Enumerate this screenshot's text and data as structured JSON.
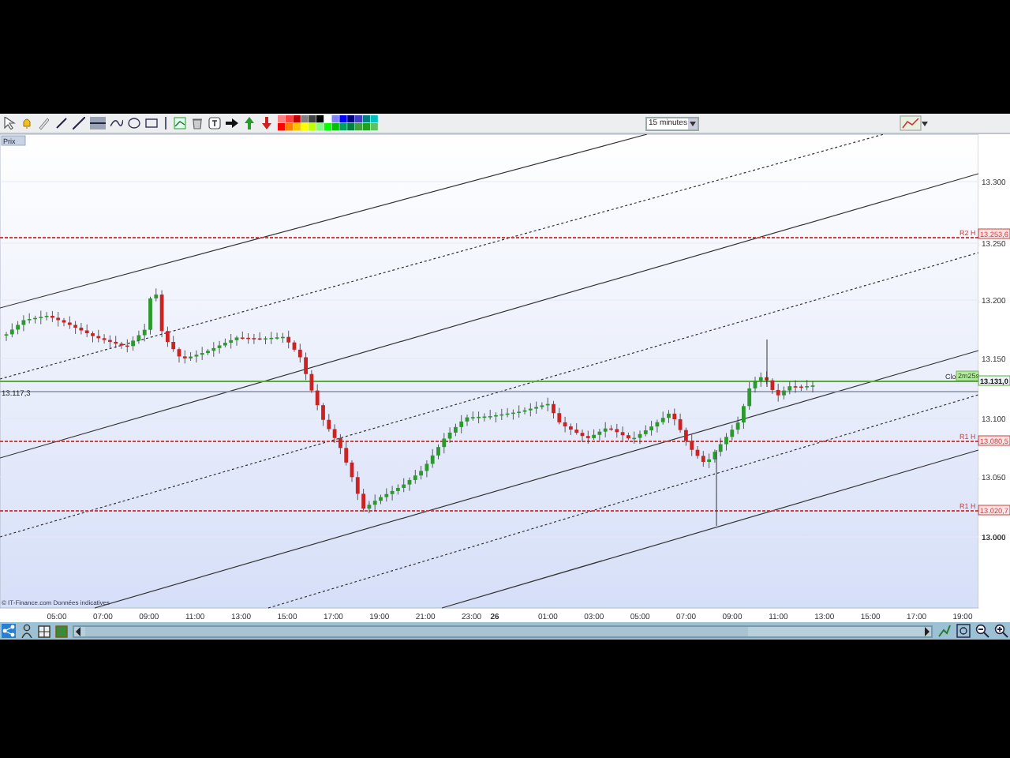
{
  "toolbar": {
    "timeframe": "15 minutes"
  },
  "chart": {
    "panel_label": "Prix",
    "y_axis_labels": [
      "13.300",
      "13.250",
      "13.200",
      "13.150",
      "13.100",
      "13.050",
      "13.000"
    ],
    "price_markers": [
      {
        "label": "R2 H",
        "value": "13.253,6",
        "color": "#d04040"
      },
      {
        "label": "Clo",
        "badge": "2m25s",
        "value": "13.131,0",
        "color": "#5aaa3a"
      },
      {
        "label": "R1 H",
        "value": "13.080,5",
        "color": "#d04040"
      },
      {
        "label": "R1 H",
        "value": "13.020,7",
        "color": "#d04040"
      }
    ],
    "left_marker": "13.117,3",
    "credit": "© IT-Finance.com  Données indicatives",
    "x_axis_labels": [
      {
        "text": "05:00",
        "bold": false
      },
      {
        "text": "07:00",
        "bold": false
      },
      {
        "text": "09:00",
        "bold": false
      },
      {
        "text": "11:00",
        "bold": false
      },
      {
        "text": "13:00",
        "bold": false
      },
      {
        "text": "15:00",
        "bold": false
      },
      {
        "text": "17:00",
        "bold": false
      },
      {
        "text": "19:00",
        "bold": false
      },
      {
        "text": "21:00",
        "bold": false
      },
      {
        "text": "23:00",
        "bold": false
      },
      {
        "text": "26",
        "bold": true
      },
      {
        "text": "01:00",
        "bold": false
      },
      {
        "text": "03:00",
        "bold": false
      },
      {
        "text": "05:00",
        "bold": false
      },
      {
        "text": "07:00",
        "bold": false
      },
      {
        "text": "09:00",
        "bold": false
      },
      {
        "text": "11:00",
        "bold": false
      },
      {
        "text": "13:00",
        "bold": false
      },
      {
        "text": "15:00",
        "bold": false
      },
      {
        "text": "17:00",
        "bold": false
      },
      {
        "text": "19:00",
        "bold": false
      }
    ]
  }
}
